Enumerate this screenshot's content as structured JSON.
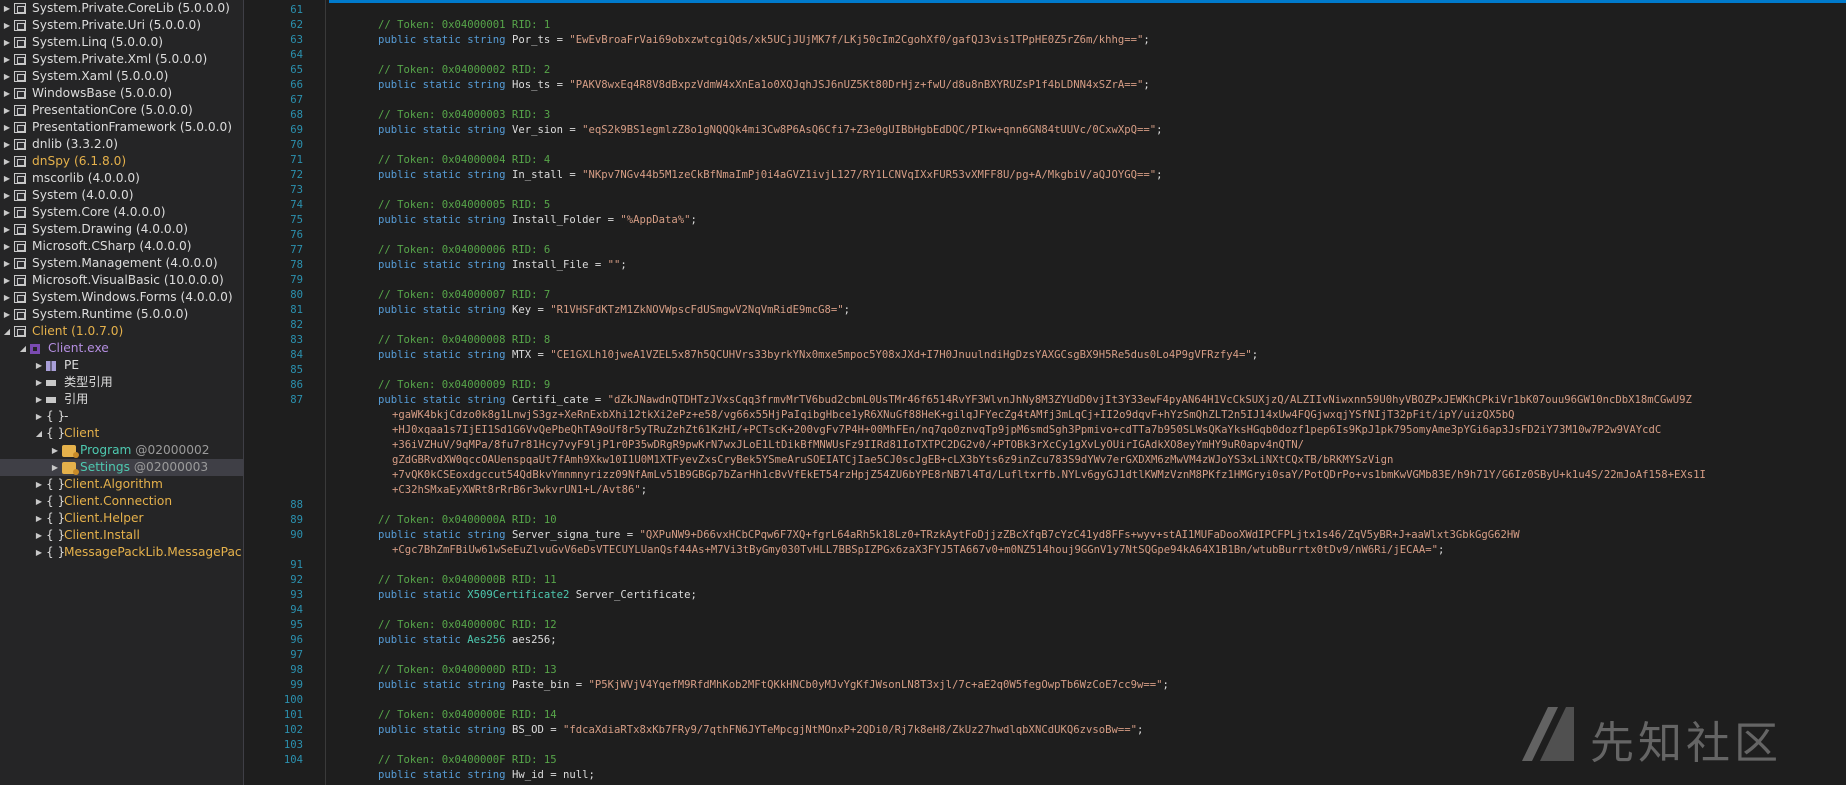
{
  "colors": {
    "accent": "#007acc",
    "namespace_label": "#e5b14b",
    "type_label": "#4ec9b0",
    "gray_label": "#9b9b9b"
  },
  "tree": [
    {
      "id": "t0",
      "label": "System.Private.CoreLib (5.0.0.0)",
      "depth": 0,
      "exp": "▶",
      "icon": "assembly-icon",
      "color": "#dcdcdc"
    },
    {
      "id": "t1",
      "label": "System.Private.Uri (5.0.0.0)",
      "depth": 0,
      "exp": "▶",
      "icon": "assembly-icon",
      "color": "#dcdcdc"
    },
    {
      "id": "t2",
      "label": "System.Linq (5.0.0.0)",
      "depth": 0,
      "exp": "▶",
      "icon": "assembly-icon",
      "color": "#dcdcdc"
    },
    {
      "id": "t3",
      "label": "System.Private.Xml (5.0.0.0)",
      "depth": 0,
      "exp": "▶",
      "icon": "assembly-icon",
      "color": "#dcdcdc"
    },
    {
      "id": "t4",
      "label": "System.Xaml (5.0.0.0)",
      "depth": 0,
      "exp": "▶",
      "icon": "assembly-icon",
      "color": "#dcdcdc"
    },
    {
      "id": "t5",
      "label": "WindowsBase (5.0.0.0)",
      "depth": 0,
      "exp": "▶",
      "icon": "assembly-icon",
      "color": "#dcdcdc"
    },
    {
      "id": "t6",
      "label": "PresentationCore (5.0.0.0)",
      "depth": 0,
      "exp": "▶",
      "icon": "assembly-icon",
      "color": "#dcdcdc"
    },
    {
      "id": "t7",
      "label": "PresentationFramework (5.0.0.0)",
      "depth": 0,
      "exp": "▶",
      "icon": "assembly-icon",
      "color": "#dcdcdc"
    },
    {
      "id": "t8",
      "label": "dnlib (3.3.2.0)",
      "depth": 0,
      "exp": "▶",
      "icon": "assembly-icon",
      "color": "#dcdcdc"
    },
    {
      "id": "t9",
      "label": "dnSpy (6.1.8.0)",
      "depth": 0,
      "exp": "▶",
      "icon": "assembly-icon",
      "color": "#e5b14b"
    },
    {
      "id": "t10",
      "label": "mscorlib (4.0.0.0)",
      "depth": 0,
      "exp": "▶",
      "icon": "assembly-icon",
      "color": "#dcdcdc"
    },
    {
      "id": "t11",
      "label": "System (4.0.0.0)",
      "depth": 0,
      "exp": "▶",
      "icon": "assembly-icon",
      "color": "#dcdcdc"
    },
    {
      "id": "t12",
      "label": "System.Core (4.0.0.0)",
      "depth": 0,
      "exp": "▶",
      "icon": "assembly-icon",
      "color": "#dcdcdc"
    },
    {
      "id": "t13",
      "label": "System.Drawing (4.0.0.0)",
      "depth": 0,
      "exp": "▶",
      "icon": "assembly-icon",
      "color": "#dcdcdc"
    },
    {
      "id": "t14",
      "label": "Microsoft.CSharp (4.0.0.0)",
      "depth": 0,
      "exp": "▶",
      "icon": "assembly-icon",
      "color": "#dcdcdc"
    },
    {
      "id": "t15",
      "label": "System.Management (4.0.0.0)",
      "depth": 0,
      "exp": "▶",
      "icon": "assembly-icon",
      "color": "#dcdcdc"
    },
    {
      "id": "t16",
      "label": "Microsoft.VisualBasic (10.0.0.0)",
      "depth": 0,
      "exp": "▶",
      "icon": "assembly-icon",
      "color": "#dcdcdc"
    },
    {
      "id": "t17",
      "label": "System.Windows.Forms (4.0.0.0)",
      "depth": 0,
      "exp": "▶",
      "icon": "assembly-icon",
      "color": "#dcdcdc"
    },
    {
      "id": "t18",
      "label": "System.Runtime (5.0.0.0)",
      "depth": 0,
      "exp": "▶",
      "icon": "assembly-icon",
      "color": "#dcdcdc"
    },
    {
      "id": "t19",
      "label": "Client (1.0.7.0)",
      "depth": 0,
      "exp": "◢",
      "icon": "assembly-icon",
      "color": "#e5b14b"
    },
    {
      "id": "t20",
      "label": "Client.exe",
      "depth": 1,
      "exp": "◢",
      "icon": "module-icon",
      "color": "#b48ee0"
    },
    {
      "id": "t21",
      "label": "PE",
      "depth": 2,
      "exp": "▶",
      "icon": "pe-icon",
      "color": "#dcdcdc"
    },
    {
      "id": "t22",
      "label": "类型引用",
      "depth": 2,
      "exp": "▶",
      "icon": "reference-icon",
      "color": "#dcdcdc"
    },
    {
      "id": "t23",
      "label": "引用",
      "depth": 2,
      "exp": "▶",
      "icon": "reference-icon",
      "color": "#dcdcdc"
    },
    {
      "id": "t24",
      "label": "-",
      "depth": 2,
      "exp": "▶",
      "icon": "namespace-icon",
      "color": "#dcdcdc"
    },
    {
      "id": "t25",
      "label": "Client",
      "depth": 2,
      "exp": "◢",
      "icon": "namespace-icon",
      "color": "#e5b14b"
    },
    {
      "id": "t26",
      "label": "Program",
      "suffix": " @02000002",
      "depth": 3,
      "exp": "▶",
      "icon": "class-icon",
      "color": "#4ec9b0"
    },
    {
      "id": "t27",
      "label": "Settings",
      "suffix": " @02000003",
      "depth": 3,
      "exp": "▶",
      "icon": "class-icon",
      "color": "#4ec9b0",
      "selected": true
    },
    {
      "id": "t28",
      "label": "Client.Algorithm",
      "depth": 2,
      "exp": "▶",
      "icon": "namespace-icon",
      "color": "#e5b14b"
    },
    {
      "id": "t29",
      "label": "Client.Connection",
      "depth": 2,
      "exp": "▶",
      "icon": "namespace-icon",
      "color": "#e5b14b"
    },
    {
      "id": "t30",
      "label": "Client.Helper",
      "depth": 2,
      "exp": "▶",
      "icon": "namespace-icon",
      "color": "#e5b14b"
    },
    {
      "id": "t31",
      "label": "Client.Install",
      "depth": 2,
      "exp": "▶",
      "icon": "namespace-icon",
      "color": "#e5b14b"
    },
    {
      "id": "t32",
      "label": "MessagePackLib.MessagePac",
      "depth": 2,
      "exp": "▶",
      "icon": "namespace-icon",
      "color": "#e5b14b"
    }
  ],
  "code": [
    {
      "ln": "61",
      "parts": []
    },
    {
      "ln": "62",
      "parts": [
        [
          "c",
          "// Token: 0x04000001 RID: 1"
        ]
      ]
    },
    {
      "ln": "63",
      "parts": [
        [
          "k",
          "public static string "
        ],
        [
          "n",
          "Por_ts = "
        ],
        [
          "s",
          "\"EwEvBroaFrVai69obxzwtcgiQds/xk5UCjJUjMK7f/LKj50cIm2CgohXf0/gafQJ3vis1TPpHE0Z5rZ6m/khhg==\""
        ],
        [
          "n",
          ";"
        ]
      ]
    },
    {
      "ln": "64",
      "parts": []
    },
    {
      "ln": "65",
      "parts": [
        [
          "c",
          "// Token: 0x04000002 RID: 2"
        ]
      ]
    },
    {
      "ln": "66",
      "parts": [
        [
          "k",
          "public static string "
        ],
        [
          "n",
          "Hos_ts = "
        ],
        [
          "s",
          "\"PAKV8wxEq4R8V8dBxpzVdmW4xXnEa1o0XQJqhJSJ6nUZ5Kt80DrHjz+fwU/d8u8nBXYRUZsP1f4bLDNN4xSZrA==\""
        ],
        [
          "n",
          ";"
        ]
      ]
    },
    {
      "ln": "67",
      "parts": []
    },
    {
      "ln": "68",
      "parts": [
        [
          "c",
          "// Token: 0x04000003 RID: 3"
        ]
      ]
    },
    {
      "ln": "69",
      "parts": [
        [
          "k",
          "public static string "
        ],
        [
          "n",
          "Ver_sion = "
        ],
        [
          "s",
          "\"eqS2k9BS1egmlzZ8o1gNQQQk4mi3Cw8P6AsQ6Cfi7+Z3e0gUIBbHgbEdDQC/PIkw+qnn6GN84tUUVc/0CxwXpQ==\""
        ],
        [
          "n",
          ";"
        ]
      ]
    },
    {
      "ln": "70",
      "parts": []
    },
    {
      "ln": "71",
      "parts": [
        [
          "c",
          "// Token: 0x04000004 RID: 4"
        ]
      ]
    },
    {
      "ln": "72",
      "parts": [
        [
          "k",
          "public static string "
        ],
        [
          "n",
          "In_stall = "
        ],
        [
          "s",
          "\"NKpv7NGv44b5M1zeCkBfNmaImPj0i4aGVZ1ivjL127/RY1LCNVqIXxFUR53vXMFF8U/pg+A/MkgbiV/aQJOYGQ==\""
        ],
        [
          "n",
          ";"
        ]
      ]
    },
    {
      "ln": "73",
      "parts": []
    },
    {
      "ln": "74",
      "parts": [
        [
          "c",
          "// Token: 0x04000005 RID: 5"
        ]
      ]
    },
    {
      "ln": "75",
      "parts": [
        [
          "k",
          "public static string "
        ],
        [
          "n",
          "Install_Folder = "
        ],
        [
          "s",
          "\"%AppData%\""
        ],
        [
          "n",
          ";"
        ]
      ]
    },
    {
      "ln": "76",
      "parts": []
    },
    {
      "ln": "77",
      "parts": [
        [
          "c",
          "// Token: 0x04000006 RID: 6"
        ]
      ]
    },
    {
      "ln": "78",
      "parts": [
        [
          "k",
          "public static string "
        ],
        [
          "n",
          "Install_File = "
        ],
        [
          "s",
          "\"\""
        ],
        [
          "n",
          ";"
        ]
      ]
    },
    {
      "ln": "79",
      "parts": []
    },
    {
      "ln": "80",
      "parts": [
        [
          "c",
          "// Token: 0x04000007 RID: 7"
        ]
      ]
    },
    {
      "ln": "81",
      "parts": [
        [
          "k",
          "public static string "
        ],
        [
          "n",
          "Key = "
        ],
        [
          "s",
          "\"R1VHSFdKTzM1ZkNOVWpscFdUSmgwV2NqVmRidE9mcG8=\""
        ],
        [
          "n",
          ";"
        ]
      ]
    },
    {
      "ln": "82",
      "parts": []
    },
    {
      "ln": "83",
      "parts": [
        [
          "c",
          "// Token: 0x04000008 RID: 8"
        ]
      ]
    },
    {
      "ln": "84",
      "parts": [
        [
          "k",
          "public static string "
        ],
        [
          "n",
          "MTX = "
        ],
        [
          "s",
          "\"CE1GXLh10jweA1VZEL5x87h5QCUHVrs33byrkYNx0mxe5mpoc5Y08xJXd+I7H0JnuulndiHgDzsYAXGCsgBX9H5Re5dus0Lo4P9gVFRzfy4=\""
        ],
        [
          "n",
          ";"
        ]
      ]
    },
    {
      "ln": "85",
      "parts": []
    },
    {
      "ln": "86",
      "parts": [
        [
          "c",
          "// Token: 0x04000009 RID: 9"
        ]
      ]
    },
    {
      "ln": "87",
      "parts": [
        [
          "k",
          "public static string "
        ],
        [
          "n",
          "Certifi_cate = "
        ],
        [
          "s",
          "\"dZkJNawdnQTDHTzJVxsCqq3frmvMrTV6bud2cbmL0UsTMr46f6514RvYF3WlvnJhNy8M3ZYUdD0vjIt3Y33ewF4pyAN64H1VcCkSUXjzQ/ALZIIvNiwxnn59U0hyVBOZPxJEWKhCPkiVr1bK07ouu96GW10ncDbX18mCGwU9Z"
        ]
      ]
    },
    {
      "ln": "",
      "cont": true,
      "parts": [
        [
          "s",
          "+gaWK4bkjCdzo0k8g1LnwjS3gz+XeRnExbXhi12tkXi2ePz+e58/vg66x55HjPaIqibgHbce1yR6XNuGf88HeK+gilqJFYecZg4tAMfj3mLqCj+II2o9dqvF+hYzSmQhZLT2n5IJ14xUw4FQGjwxqjYSfNIjT32pFit/ipY/uizQX5bQ"
        ]
      ]
    },
    {
      "ln": "",
      "cont": true,
      "parts": [
        [
          "s",
          "+HJ0xqaa1s7IjEI1Sd1G6VvQePbeQhTA9oUf8r5yTRuZzhZt61KzHI/+PCTscK+200vgFv7P4H+00MhFEn/nq7qo0znvqTp9jpM6smdSgh3Ppmivo+cdTTa7b950SLWsQKaYksHGqb0dozf1pep6Is9KpJ1pk795omyAme3pYGi6ap3JsFD2iY73M10w7P2w9VAYcdC"
        ]
      ]
    },
    {
      "ln": "",
      "cont": true,
      "parts": [
        [
          "s",
          "+36iVZHuV/9qMPa/8fu7r81Hcy7vyF9ljP1r0P35wDRgR9pwKrN7wxJLoE1LtDikBfMNWUsFz9IIRd81IoTXTPC2DG2v0/+PTOBk3rXcCy1gXvLyOUirIGAdkXO8eyYmHY9uR0apv4nQTN/"
        ]
      ]
    },
    {
      "ln": "",
      "cont": true,
      "parts": [
        [
          "s",
          "gZdGBRvdXW0qccOAUenspqaUt7fAmh9Xkw10I1U0M1XTFyevZxsCryBek5YSmeAruSOEIATCjIae5CJ0scJgEB+cLX3bYts6z9inZcu783S9dYWv7erGXDXM6zMwVM4zWJoYS3xLiNXtCQxTB/bRKMYSzVign"
        ]
      ]
    },
    {
      "ln": "",
      "cont": true,
      "parts": [
        [
          "s",
          "+7vQK0kCSEoxdgccut54QdBkvYmnmnyrizz09NfAmLv51B9GBGp7bZarHh1cBvVfEkET54rzHpjZ54ZU6bYPE8rNB7l4Td/Lufltxrfb.NYLv6gyGJ1dtlKWMzVznM8PKfz1HMGryi0saY/PotQDrPo+vs1bmKwVGMb83E/h9h71Y/G6Iz0SByU+k1u4S/22mJoAf158+EXs1I"
        ]
      ]
    },
    {
      "ln": "",
      "cont": true,
      "parts": [
        [
          "s",
          "+C32hSMxaEyXWRt8rRrB6r3wkvrUN1+L/Avt86\""
        ],
        [
          "n",
          ";"
        ]
      ]
    },
    {
      "ln": "88",
      "parts": []
    },
    {
      "ln": "89",
      "parts": [
        [
          "c",
          "// Token: 0x0400000A RID: 10"
        ]
      ]
    },
    {
      "ln": "90",
      "parts": [
        [
          "k",
          "public static string "
        ],
        [
          "n",
          "Server_signa_ture = "
        ],
        [
          "s",
          "\"QXPuNW9+D66vxHCbCPqw6F7XQ+fgrL64aRh5k18Lz0+TRzkAytFoDjjzZBcXfqB7cYzC41yd8FFs+wyv+stAI1MUFaDooXWdIPCFPLjtx1s46/ZqV5yBR+J+aaWlxt3GbkGgG62HW"
        ]
      ]
    },
    {
      "ln": "",
      "cont": true,
      "parts": [
        [
          "s",
          "+Cgc7BhZmFBiUw61wSeEuZlvuGvV6eDsVTECUYLUanQsf44As+M7Vi3tByGmy030TvHLL7BBSpIZPGx6zaX3FYJ5TA667v0+m0NZ514houj9GGnV1y7NtSQGpe94kA64X1B1Bn/wtubBurrtx0tDv9/nW6Ri/jECAA=\""
        ],
        [
          "n",
          ";"
        ]
      ]
    },
    {
      "ln": "91",
      "parts": []
    },
    {
      "ln": "92",
      "parts": [
        [
          "c",
          "// Token: 0x0400000B RID: 11"
        ]
      ]
    },
    {
      "ln": "93",
      "parts": [
        [
          "k",
          "public static "
        ],
        [
          "t",
          "X509Certificate2"
        ],
        [
          "n",
          " Server_Certificate;"
        ]
      ]
    },
    {
      "ln": "94",
      "parts": []
    },
    {
      "ln": "95",
      "parts": [
        [
          "c",
          "// Token: 0x0400000C RID: 12"
        ]
      ]
    },
    {
      "ln": "96",
      "parts": [
        [
          "k",
          "public static "
        ],
        [
          "t",
          "Aes256"
        ],
        [
          "n",
          " aes256;"
        ]
      ]
    },
    {
      "ln": "97",
      "parts": []
    },
    {
      "ln": "98",
      "parts": [
        [
          "c",
          "// Token: 0x0400000D RID: 13"
        ]
      ]
    },
    {
      "ln": "99",
      "parts": [
        [
          "k",
          "public static string "
        ],
        [
          "n",
          "Paste_bin = "
        ],
        [
          "s",
          "\"P5KjWVjV4YqefM9RfdMhKob2MFtQKkHNCb0yMJvYgKfJWsonLN8T3xjl/7c+aE2q0W5fegOwpTb6WzCoE7cc9w==\""
        ],
        [
          "n",
          ";"
        ]
      ]
    },
    {
      "ln": "100",
      "parts": []
    },
    {
      "ln": "101",
      "parts": [
        [
          "c",
          "// Token: 0x0400000E RID: 14"
        ]
      ]
    },
    {
      "ln": "102",
      "parts": [
        [
          "k",
          "public static string "
        ],
        [
          "n",
          "BS_OD = "
        ],
        [
          "s",
          "\"fdcaXdiaRTx8xKb7FRy9/7qthFN6JYTeMpcgjNtMOnxP+2QDi0/Rj7k8eH8/ZkUz27hwdlqbXNCdUKQ6zvsoBw==\""
        ],
        [
          "n",
          ";"
        ]
      ]
    },
    {
      "ln": "103",
      "parts": []
    },
    {
      "ln": "104",
      "parts": [
        [
          "c",
          "// Token: 0x0400000F RID: 15"
        ]
      ]
    },
    {
      "ln": "",
      "parts": [
        [
          "k",
          "public static string "
        ],
        [
          "n",
          "Hw_id = null;"
        ]
      ]
    }
  ],
  "watermark": {
    "text": "先知社区"
  }
}
